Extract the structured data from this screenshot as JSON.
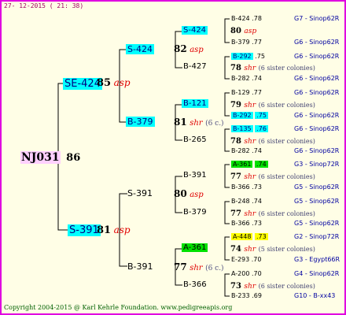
{
  "header": {
    "timestamp": "27- 12-2015 ( 21: 38)"
  },
  "footer": {
    "copyright": "Copyright 2004-2015 @ Karl Kehrle Foundation.   www.pedigreeapis.org"
  },
  "root": {
    "id": "NJ031",
    "year": "86"
  },
  "gen1": {
    "top": {
      "id": "SE-424",
      "year": "85",
      "ins": "asp"
    },
    "bottom": {
      "id": "S-391",
      "year": "81",
      "ins": "asp"
    }
  },
  "gen2": [
    {
      "id": "S-424"
    },
    {
      "id": "B-379"
    },
    {
      "id": "S-391"
    },
    {
      "id": "B-391"
    }
  ],
  "gen3_mid": [
    {
      "year": "82",
      "ins": "asp",
      "extra": ""
    },
    {
      "year": "81",
      "ins": "shr",
      "extra": "(6 c.)"
    },
    {
      "year": "80",
      "ins": "asp",
      "extra": ""
    },
    {
      "year": "77",
      "ins": "shr",
      "extra": "(6 c.)"
    }
  ],
  "gen3": [
    {
      "id": "S-424"
    },
    {
      "id": "B-427"
    },
    {
      "id": "B-121"
    },
    {
      "id": "B-265"
    },
    {
      "id": "B-391"
    },
    {
      "id": "B-379"
    },
    {
      "id": "A-361"
    },
    {
      "id": "B-366"
    }
  ],
  "gen4_mid": [
    {
      "year": "80",
      "ins": "asp",
      "extra": ""
    },
    {
      "year": "78",
      "ins": "shr",
      "extra": "(6 sister colonies)"
    },
    {
      "year": "79",
      "ins": "shr",
      "extra": "(6 sister colonies)"
    },
    {
      "year": "78",
      "ins": "shr",
      "extra": "(6 sister colonies)"
    },
    {
      "year": "77",
      "ins": "shr",
      "extra": "(6 sister colonies)"
    },
    {
      "year": "77",
      "ins": "shr",
      "extra": "(6 sister colonies)"
    },
    {
      "year": "74",
      "ins": "shr",
      "extra": "(5 sister colonies)"
    },
    {
      "year": "73",
      "ins": "shr",
      "extra": "(6 sister colonies)"
    }
  ],
  "gen4": [
    {
      "id": "B-424",
      "yr": ".78",
      "code": "G7 - Sinop62R"
    },
    {
      "id": "B-379",
      "yr": ".77",
      "code": "G6 - Sinop62R"
    },
    {
      "id": "B-292",
      "yr": ".75",
      "code": "G6 - Sinop62R"
    },
    {
      "id": "B-282",
      "yr": ".74",
      "code": "G6 - Sinop62R"
    },
    {
      "id": "B-129",
      "yr": ".77",
      "code": "G6 - Sinop62R"
    },
    {
      "id": "B-292",
      "yr": ".75",
      "code": "G6 - Sinop62R"
    },
    {
      "id": "B-135",
      "yr": ".76",
      "code": "G6 - Sinop62R"
    },
    {
      "id": "B-282",
      "yr": ".74",
      "code": "G6 - Sinop62R"
    },
    {
      "id": "A-361",
      "yr": ".74",
      "code": "G3 - Sinop72R"
    },
    {
      "id": "B-366",
      "yr": ".73",
      "code": "G5 - Sinop62R"
    },
    {
      "id": "B-248",
      "yr": ".74",
      "code": "G5 - Sinop62R"
    },
    {
      "id": "B-366",
      "yr": ".73",
      "code": "G5 - Sinop62R"
    },
    {
      "id": "A-448",
      "yr": ".73",
      "code": "G2 - Sinop72R"
    },
    {
      "id": "E-293",
      "yr": ".70",
      "code": "G3 - Egypt66R"
    },
    {
      "id": "A-200",
      "yr": ".70",
      "code": "G4 - Sinop62R"
    },
    {
      "id": "B-233",
      "yr": ".69",
      "code": "G10 - B-xx43"
    }
  ],
  "colors": {
    "border": "#e000e0",
    "background": "#fffee6",
    "cyan": "#00ffff",
    "green": "#00e000",
    "yellow": "#ffff00",
    "insemination": "#e00000"
  }
}
